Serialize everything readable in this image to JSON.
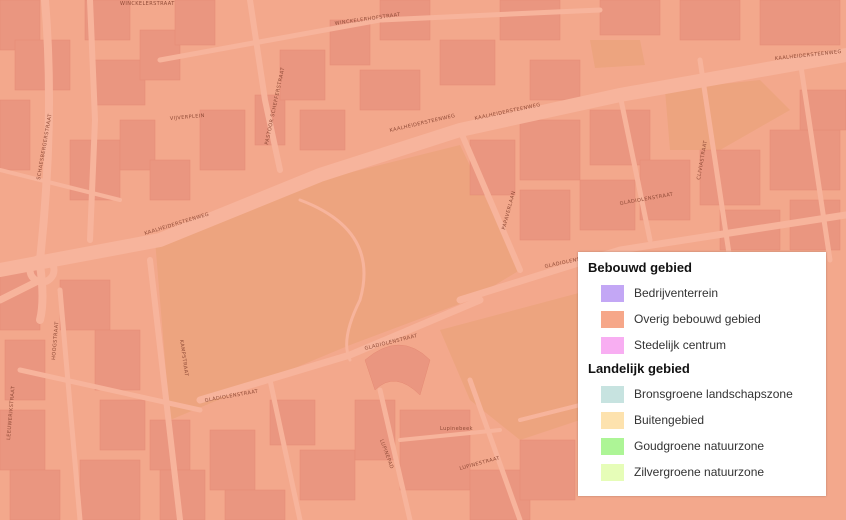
{
  "legend": {
    "groups": [
      {
        "title": "Bebouwd gebied",
        "items": [
          {
            "label": "Bedrijventerrein",
            "color": "#c3a7f5"
          },
          {
            "label": "Overig bebouwd gebied",
            "color": "#f6a789"
          },
          {
            "label": "Stedelijk centrum",
            "color": "#f8aef2"
          }
        ]
      },
      {
        "title": "Landelijk gebied",
        "items": [
          {
            "label": "Bronsgroene landschapszone",
            "color": "#c7e3e0"
          },
          {
            "label": "Buitengebied",
            "color": "#fde2ae"
          },
          {
            "label": "Goudgroene natuurzone",
            "color": "#adf596"
          },
          {
            "label": "Zilvergroene natuurzone",
            "color": "#e6fdb8"
          }
        ]
      }
    ]
  },
  "map": {
    "background_color": "#f3a88c",
    "block_color": "#ea9680",
    "road_color": "#f7b49c",
    "park_color": "#eda47f",
    "street_labels": {
      "kaalheide_1": "KAALHEIDERSTEENWEG",
      "kaalheide_2": "KAALHEIDERSTEENWEG",
      "kaalheide_3": "KAALHEIDERSTEENWEG",
      "kaalheide_4": "KAALHEIDERSTEENWEG",
      "schaesberg": "SCHAESBERGERSTRAAT",
      "winckel": "WINCKELERSTRAAT",
      "winckelerhof": "WINCKELERHOFSTRAAT",
      "vijverplein": "VIJVERPLEIN",
      "pastoor": "PASTOOR SCHEFFERSTRAAT",
      "gladiolen_1": "GLADIOLENSTRAAT",
      "gladiolen_2": "GLADIOLENSTRAAT",
      "gladiolen_3": "GLADIOLENSTRAAT",
      "gladiolen_4": "GLADIOLENSTRAAT",
      "papaver": "PAPAVERLAAN",
      "kamp": "KAMPSTRAAT",
      "hoogstraat": "HOOGSTRAAT",
      "lupinestraat": "LUPINESTRAAT",
      "clivia": "CLIVIASTRAAT",
      "leeuwerik": "LEEUWERIKSTRAAT",
      "lupinepad": "LUPINEPAD",
      "lupinebeek": "Lupinebeek"
    }
  }
}
